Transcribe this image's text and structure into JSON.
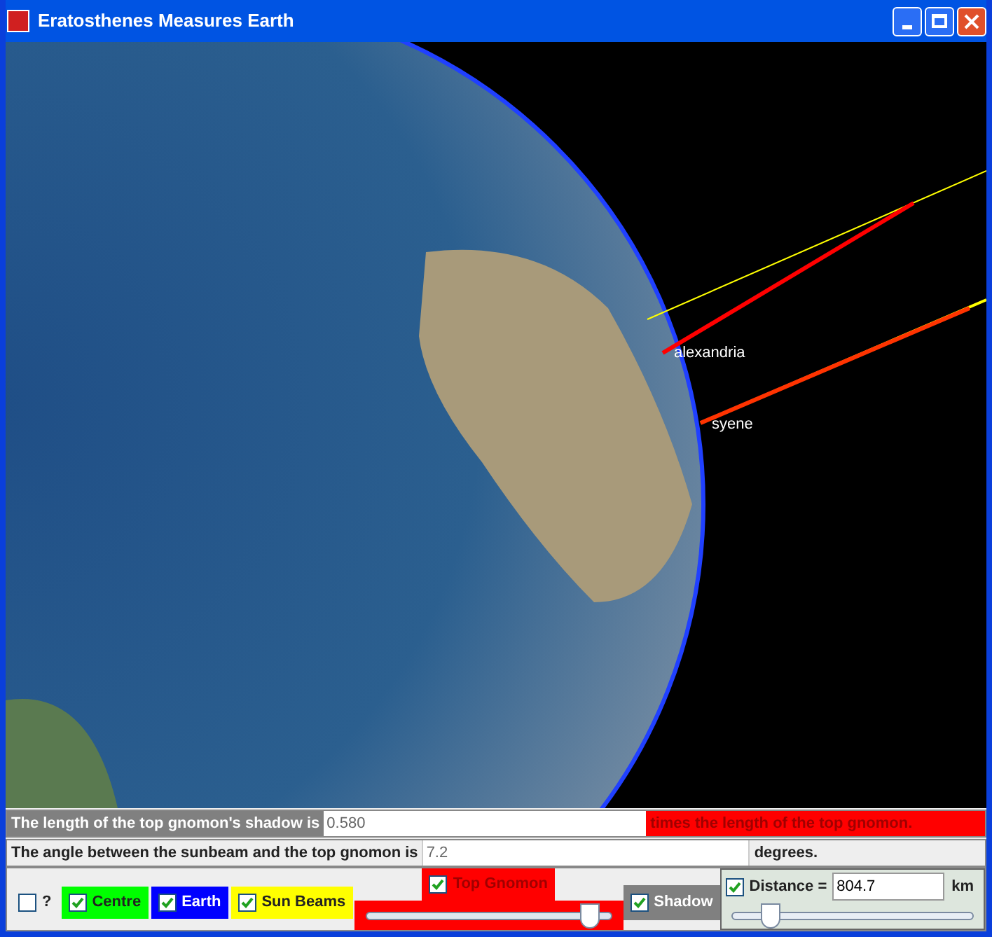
{
  "window": {
    "title": "Eratosthenes Measures Earth"
  },
  "scene": {
    "cities": [
      {
        "name": "alexandria"
      },
      {
        "name": "syene"
      }
    ]
  },
  "shadow_row": {
    "label": "The length of the top gnomon's shadow is",
    "value": "0.580",
    "suffix": "times the length of the top gnomon."
  },
  "angle_row": {
    "label": "The angle between the sunbeam and the top gnomon is",
    "value": "7.2",
    "suffix": "degrees."
  },
  "controls": {
    "checkboxes": [
      {
        "label": "?",
        "checked": false,
        "color": "#eeeeee"
      },
      {
        "label": "Centre",
        "checked": true,
        "color": "#00ff00"
      },
      {
        "label": "Earth",
        "checked": true,
        "color": "#0000ff"
      },
      {
        "label": "Sun Beams",
        "checked": true,
        "color": "#ffff00"
      }
    ],
    "top_gnomon": {
      "label": "Top Gnomon",
      "checked": true,
      "level": 0.91
    },
    "shadow": {
      "label": "Shadow",
      "checked": true
    },
    "distance": {
      "label": "Distance =",
      "checked": true,
      "value": "804.7",
      "unit": "km",
      "level": 0.16
    }
  }
}
